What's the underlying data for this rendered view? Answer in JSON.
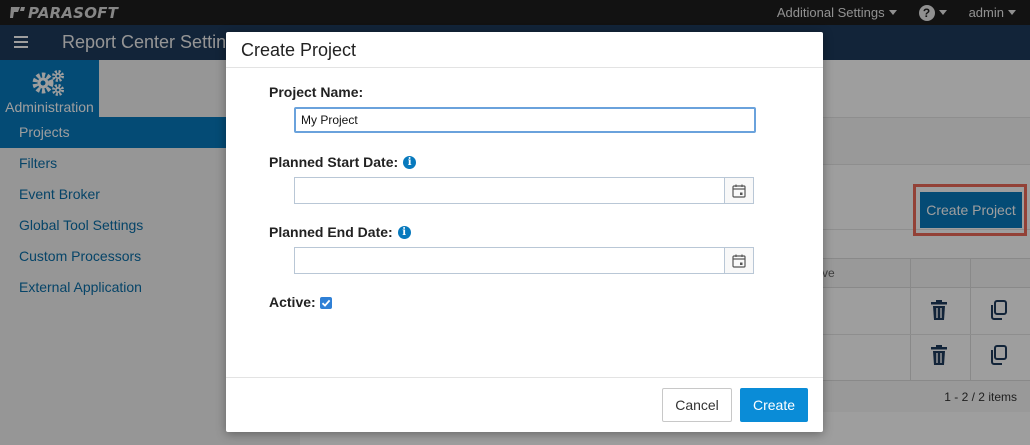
{
  "topbar": {
    "logo_text": "PARASOFT",
    "additional_settings": "Additional Settings",
    "help_symbol": "?",
    "user": "admin"
  },
  "header": {
    "title": "Report Center Settings"
  },
  "sidebar": {
    "admin_label": "Administration",
    "items": [
      {
        "label": "Projects",
        "active": true
      },
      {
        "label": "Filters",
        "active": false
      },
      {
        "label": "Event Broker",
        "active": false
      },
      {
        "label": "Global Tool Settings",
        "active": false
      },
      {
        "label": "Custom Processors",
        "active": false
      },
      {
        "label": "External Application",
        "active": false
      }
    ]
  },
  "background": {
    "create_button": "Create Project",
    "table_header_partial": "ve",
    "pager": "1 - 2 / 2 items"
  },
  "modal": {
    "title": "Create Project",
    "project_name_label": "Project Name:",
    "project_name_value": "My Project",
    "start_date_label": "Planned Start Date:",
    "start_date_value": "",
    "end_date_label": "Planned End Date:",
    "end_date_value": "",
    "active_label": "Active:",
    "active_checked": true,
    "info_symbol": "i",
    "cancel_label": "Cancel",
    "create_label": "Create"
  },
  "colors": {
    "accent": "#0779bd",
    "navbar": "#1d3a5c",
    "highlight": "#ee6a5a"
  }
}
